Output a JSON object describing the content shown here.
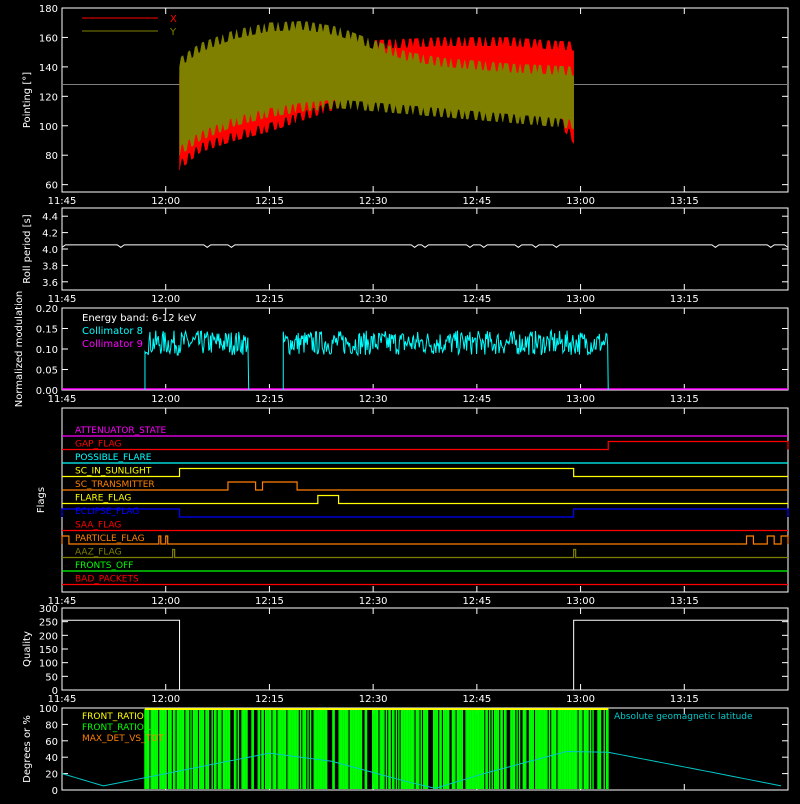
{
  "time_ticks": [
    "11:45",
    "12:00",
    "12:15",
    "12:30",
    "12:45",
    "13:00",
    "13:15"
  ],
  "colors": {
    "red": "#ff0000",
    "olive": "#808000",
    "white": "#ffffff",
    "cyan": "#00ffff",
    "magenta": "#ff00ff",
    "yellow": "#ffff00",
    "orange": "#ff8000",
    "blue": "#0000ff",
    "green": "#00ff00",
    "teal": "#00c8c8",
    "grey": "#808080"
  },
  "chart_data": [
    {
      "id": "pointing",
      "type": "line",
      "ylabel": "Pointing [°]",
      "ylim": [
        55,
        180
      ],
      "yticks": [
        "60",
        "80",
        "100",
        "120",
        "140",
        "160",
        "180"
      ],
      "reference_line": 128,
      "legend": [
        {
          "name": "X",
          "color": "#ff0000"
        },
        {
          "name": "Y",
          "color": "#808000"
        }
      ],
      "series": [
        {
          "name": "X",
          "color": "#ff0000",
          "x_start": "12:02",
          "x_end": "12:59",
          "envelope_times": [
            "12:02",
            "12:05",
            "12:10",
            "12:15",
            "12:20",
            "12:25",
            "12:30",
            "12:35",
            "12:40",
            "12:45",
            "12:50",
            "12:55",
            "12:59"
          ],
          "upper": [
            140,
            150,
            158,
            162,
            162,
            159,
            158,
            159,
            160,
            160,
            160,
            158,
            157
          ],
          "lower": [
            70,
            82,
            90,
            96,
            104,
            112,
            118,
            118,
            116,
            114,
            112,
            113,
            88
          ]
        },
        {
          "name": "Y",
          "color": "#808000",
          "x_start": "12:02",
          "x_end": "12:59",
          "envelope_times": [
            "12:02",
            "12:05",
            "12:10",
            "12:15",
            "12:20",
            "12:25",
            "12:30",
            "12:35",
            "12:40",
            "12:45",
            "12:50",
            "12:55",
            "12:59"
          ],
          "upper": [
            146,
            156,
            165,
            170,
            171,
            167,
            158,
            150,
            146,
            144,
            142,
            141,
            140
          ],
          "lower": [
            80,
            90,
            100,
            106,
            110,
            112,
            110,
            108,
            106,
            104,
            102,
            100,
            98
          ]
        }
      ]
    },
    {
      "id": "roll",
      "type": "line",
      "ylabel": "Roll period [s]",
      "ylim": [
        3.5,
        4.5
      ],
      "yticks": [
        "3.6",
        "3.8",
        "4.0",
        "4.2",
        "4.4"
      ],
      "series": [
        {
          "name": "",
          "color": "#ffffff",
          "x_start": "11:45",
          "x_end": "13:30",
          "level": 4.05
        }
      ]
    },
    {
      "id": "modulation",
      "type": "line",
      "ylabel": "Normalized modulation",
      "ylim": [
        0,
        0.2
      ],
      "yticks": [
        "0.00",
        "0.05",
        "0.10",
        "0.15",
        "0.20"
      ],
      "annotation": "Energy band: 6-12 keV",
      "legend": [
        {
          "name": "Collimator 8",
          "color": "#00ffff"
        },
        {
          "name": "Collimator 9",
          "color": "#ff00ff"
        }
      ],
      "series": [
        {
          "name": "Collimator 8",
          "color": "#00ffff",
          "segments": [
            [
              "11:57",
              "12:12"
            ],
            [
              "12:17",
              "13:04"
            ]
          ],
          "mean": 0.115,
          "spread": 0.03
        },
        {
          "name": "Collimator 9",
          "color": "#ff00ff",
          "level": 0.0
        }
      ]
    },
    {
      "id": "flags",
      "type": "line",
      "ylabel": "Flags",
      "series": [
        {
          "name": "ATTENUATOR_STATE",
          "color": "#ff00ff",
          "changes": []
        },
        {
          "name": "GAP_FLAG",
          "color": "#ff0000",
          "changes": [
            [
              "13:04",
              "13:30"
            ]
          ]
        },
        {
          "name": "POSSIBLE_FLARE",
          "color": "#00ffff",
          "changes": []
        },
        {
          "name": "SC_IN_SUNLIGHT",
          "color": "#ffff00",
          "changes": [
            [
              "12:02",
              "12:59"
            ]
          ]
        },
        {
          "name": "SC_TRANSMITTER",
          "color": "#ff8000",
          "changes": [
            [
              "12:09",
              "12:13"
            ],
            [
              "12:14",
              "12:19"
            ]
          ]
        },
        {
          "name": "FLARE_FLAG",
          "color": "#ffff00",
          "changes": [
            [
              "12:22",
              "12:25"
            ]
          ]
        },
        {
          "name": "ECLIPSE_FLAG",
          "color": "#0000ff",
          "changes": [
            [
              "11:45",
              "12:02"
            ],
            [
              "12:59",
              "13:30"
            ]
          ]
        },
        {
          "name": "SAA_FLAG",
          "color": "#ff0000",
          "changes": []
        },
        {
          "name": "PARTICLE_FLAG",
          "color": "#ff8000",
          "changes": [
            [
              "11:45",
              "11:46"
            ],
            [
              "11:59",
              "11:59"
            ],
            [
              "12:00",
              "12:00"
            ],
            [
              "13:24",
              "13:25"
            ],
            [
              "13:27",
              "13:28"
            ],
            [
              "13:29",
              "13:30"
            ]
          ]
        },
        {
          "name": "AAZ_FLAG",
          "color": "#808000",
          "changes": [
            [
              "12:01",
              "12:01"
            ],
            [
              "12:59",
              "12:59"
            ]
          ]
        },
        {
          "name": "FRONTS_OFF",
          "color": "#00ff00",
          "changes": []
        },
        {
          "name": "BAD_PACKETS",
          "color": "#ff0000",
          "changes": []
        }
      ]
    },
    {
      "id": "quality",
      "type": "line",
      "ylabel": "Quality",
      "ylim": [
        0,
        300
      ],
      "yticks": [
        "0",
        "50",
        "100",
        "150",
        "200",
        "250",
        "300"
      ],
      "series": [
        {
          "name": "",
          "color": "#ffffff",
          "points": [
            [
              "11:45",
              255
            ],
            [
              "12:02",
              255
            ],
            [
              "12:02",
              0
            ],
            [
              "12:59",
              0
            ],
            [
              "12:59",
              255
            ],
            [
              "13:30",
              255
            ]
          ]
        }
      ]
    },
    {
      "id": "geomag",
      "type": "line",
      "ylabel": "Degrees or %",
      "ylim": [
        0,
        100
      ],
      "yticks": [
        "0",
        "20",
        "40",
        "60",
        "80",
        "100"
      ],
      "legend": [
        {
          "name": "FRONT_RATIO",
          "color": "#ffff00"
        },
        {
          "name": "FRONT_RATIO_...",
          "color": "#00ff00"
        },
        {
          "name": "MAX_DET_VS_TOT",
          "color": "#ff8000"
        }
      ],
      "annotation": "Absolute geomagnetic latitude",
      "series": [
        {
          "name": "Absolute geomagnetic latitude",
          "color": "#00c8c8",
          "points": [
            [
              "11:45",
              20
            ],
            [
              "11:51",
              5
            ],
            [
              "12:06",
              30
            ],
            [
              "12:15",
              45
            ],
            [
              "12:24",
              35
            ],
            [
              "12:35",
              10
            ],
            [
              "12:39",
              2
            ],
            [
              "12:46",
              20
            ],
            [
              "12:58",
              47
            ],
            [
              "13:04",
              46
            ],
            [
              "13:20",
              20
            ],
            [
              "13:29",
              5
            ]
          ]
        },
        {
          "name": "FRONT_RATIO_...",
          "color": "#00ff00",
          "segments": [
            [
              "11:57",
              "13:04"
            ]
          ]
        }
      ]
    }
  ]
}
